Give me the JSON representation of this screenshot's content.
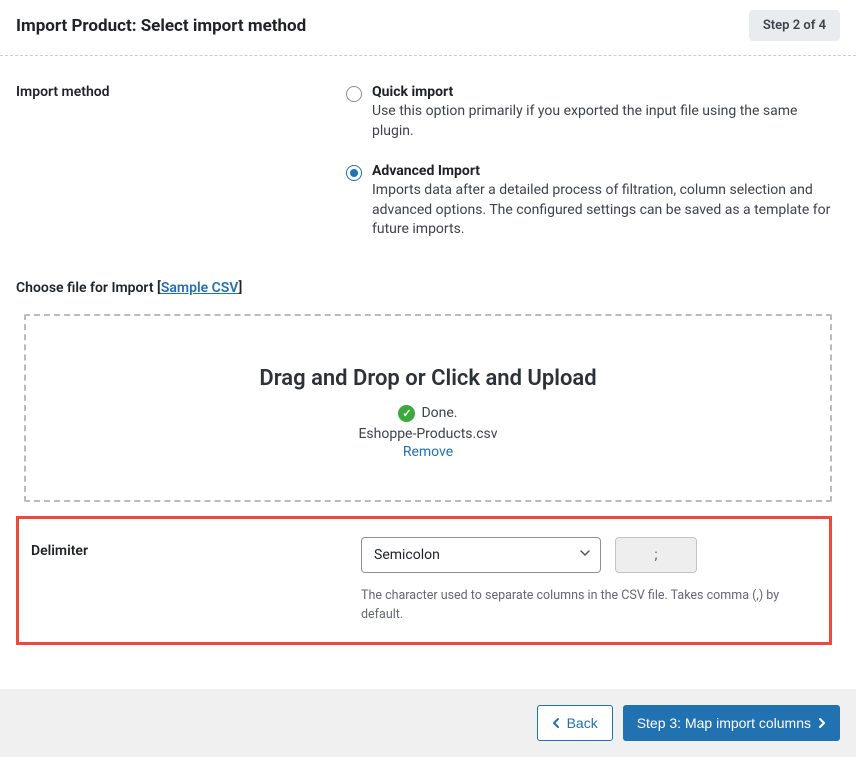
{
  "header": {
    "title": "Import Product: Select import method",
    "step_badge": "Step 2 of 4"
  },
  "import_method": {
    "label": "Import method",
    "options": [
      {
        "title": "Quick import",
        "desc": "Use this option primarily if you exported the input file using the same plugin.",
        "selected": false
      },
      {
        "title": "Advanced Import",
        "desc": "Imports data after a detailed process of filtration, column selection and advanced options. The configured settings can be saved as a template for future imports.",
        "selected": true
      }
    ]
  },
  "file_import": {
    "label_prefix": "Choose file for Import [",
    "sample_link": "Sample CSV",
    "label_suffix": "]",
    "dropzone_title": "Drag and Drop or Click and Upload",
    "done_text": "Done.",
    "filename": "Eshoppe-Products.csv",
    "remove_text": "Remove"
  },
  "delimiter": {
    "label": "Delimiter",
    "select_value": "Semicolon",
    "char_value": ";",
    "help_text": "The character used to separate columns in the CSV file. Takes comma (,) by default."
  },
  "footer": {
    "back": "Back",
    "next": "Step 3: Map import columns"
  }
}
